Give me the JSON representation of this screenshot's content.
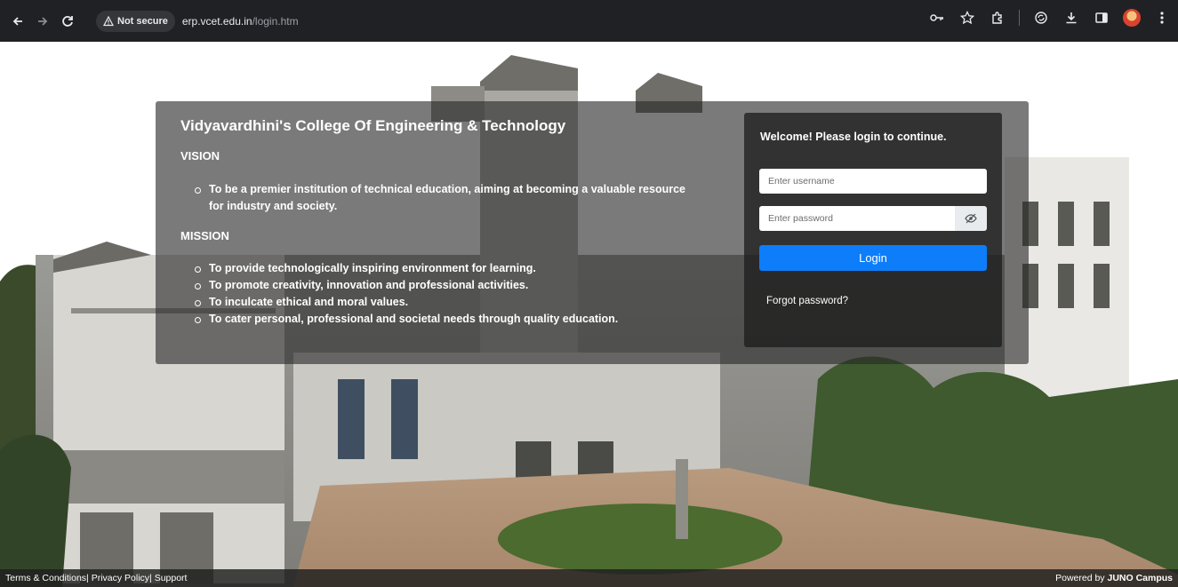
{
  "browser": {
    "security_label": "Not secure",
    "url_host": "erp.vcet.edu.in",
    "url_path": "/login.htm",
    "icons": [
      "back-icon",
      "forward-icon",
      "reload-icon",
      "warning-icon",
      "key-icon",
      "star-icon",
      "extensions-icon",
      "sync-icon",
      "download-icon",
      "sidepanel-icon",
      "avatar",
      "menu-icon"
    ]
  },
  "info": {
    "college_name": "Vidyavardhini's College Of Engineering & Technology",
    "vision_heading": "VISION",
    "vision_items": [
      "To be a premier institution of technical education, aiming at becoming a valuable resource for industry and society."
    ],
    "mission_heading": "MISSION",
    "mission_items": [
      "To provide technologically inspiring environment for learning.",
      "To promote creativity, innovation and professional activities.",
      "To inculcate ethical and moral values.",
      "To cater personal, professional and societal needs through quality education."
    ]
  },
  "login": {
    "welcome": "Welcome! Please login to continue.",
    "username_placeholder": "Enter username",
    "password_placeholder": "Enter password",
    "login_label": "Login",
    "forgot_label": "Forgot password?",
    "button_color": "#0d7dfa"
  },
  "footer": {
    "terms": "Terms & Conditions|",
    "privacy": "Privacy Policy|",
    "support": "Support",
    "powered_prefix": "Powered by",
    "powered_brand": "JUNO Campus"
  }
}
